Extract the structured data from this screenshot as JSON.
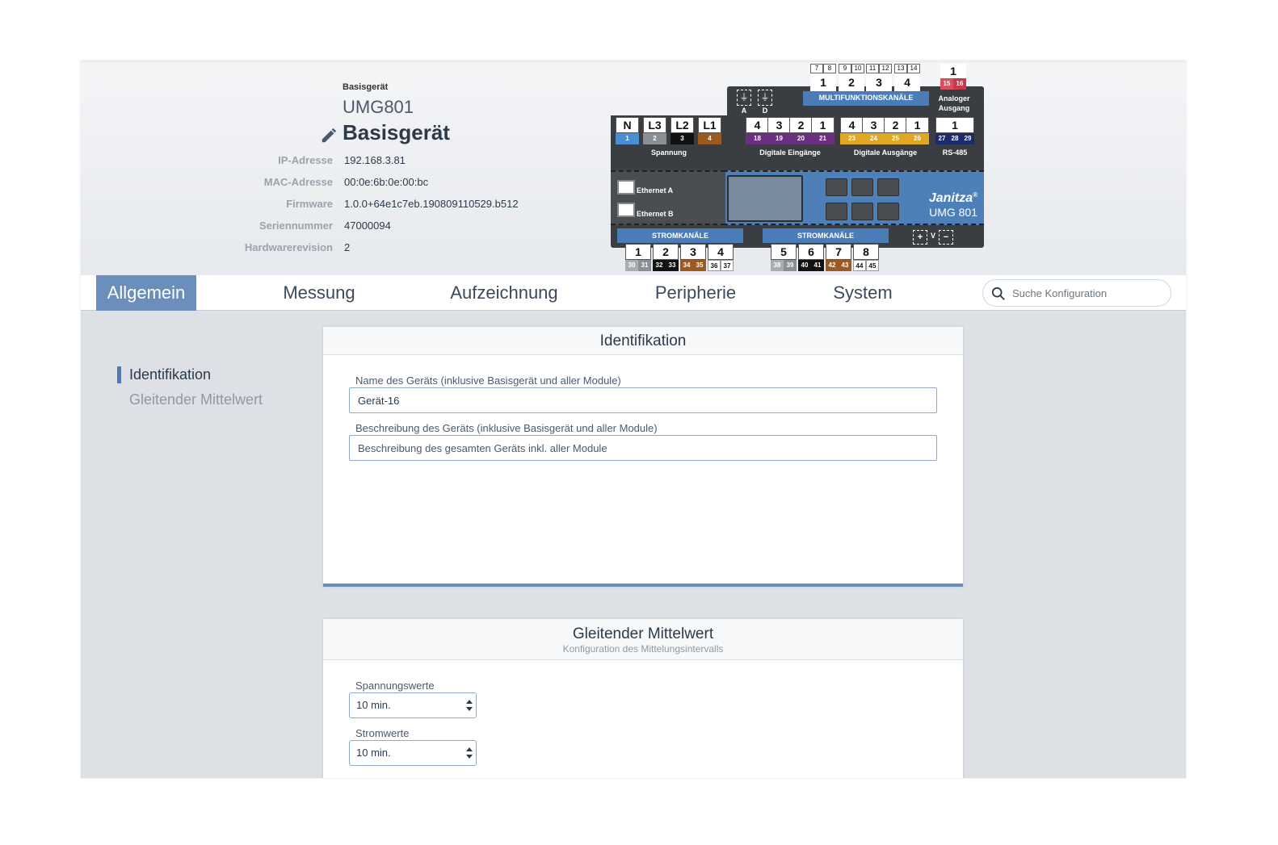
{
  "header": {
    "device_type_small": "Basisgerät",
    "device_model": "UMG801",
    "device_name": "Basisgerät",
    "info": [
      {
        "label": "IP-Adresse",
        "value": "192.168.3.81"
      },
      {
        "label": "MAC-Adresse",
        "value": "00:0e:6b:0e:00:bc"
      },
      {
        "label": "Firmware",
        "value": "1.0.0+64e1c7eb.190809110529.b512"
      },
      {
        "label": "Seriennummer",
        "value": "47000094"
      },
      {
        "label": "Hardwarerevision",
        "value": "2"
      }
    ]
  },
  "device_graphic": {
    "brand": "Janitza",
    "brand_mark": "®",
    "model": "UMG 801",
    "voltage_terminals": [
      {
        "label": "N",
        "sub": "1",
        "color": "#4a8fd4"
      },
      {
        "label": "L3",
        "sub": "2",
        "color": "#8a8f95"
      },
      {
        "label": "L2",
        "sub": "3",
        "color": "#111111"
      },
      {
        "label": "L1",
        "sub": "4",
        "color": "#9a5a22"
      }
    ],
    "voltage_label": "Spannung",
    "digital_inputs": [
      {
        "label": "4",
        "sub": "18"
      },
      {
        "label": "3",
        "sub": "19"
      },
      {
        "label": "2",
        "sub": "20"
      },
      {
        "label": "1",
        "sub": "21"
      }
    ],
    "digital_inputs_label": "Digitale Eingänge",
    "digital_outputs": [
      {
        "label": "4",
        "sub": "23"
      },
      {
        "label": "3",
        "sub": "24"
      },
      {
        "label": "2",
        "sub": "25"
      },
      {
        "label": "1",
        "sub": "26"
      }
    ],
    "digital_outputs_label": "Digitale Ausgänge",
    "rs485": {
      "label": "1",
      "subs": [
        "27",
        "28",
        "29"
      ],
      "caption": "RS-485"
    },
    "multi_label": "MULTIFUNKTIONSKANÄLE",
    "multi_small": [
      "7",
      "8",
      "9",
      "10",
      "11",
      "12",
      "13",
      "14"
    ],
    "multi_big": [
      "1",
      "2",
      "3",
      "4"
    ],
    "analog": {
      "label": "1",
      "subs": [
        "15",
        "16"
      ],
      "caption_1": "Analoger",
      "caption_2": "Ausgang"
    },
    "ad_labels": [
      "A",
      "D"
    ],
    "ethernet": [
      "Ethernet A",
      "Ethernet B"
    ],
    "current_label": "STROMKANÄLE",
    "current_left": [
      {
        "label": "1",
        "subs": [
          "30",
          "31"
        ]
      },
      {
        "label": "2",
        "subs": [
          "32",
          "33"
        ]
      },
      {
        "label": "3",
        "subs": [
          "34",
          "35"
        ]
      },
      {
        "label": "4",
        "subs": [
          "36",
          "37"
        ]
      }
    ],
    "current_right": [
      {
        "label": "5",
        "subs": [
          "38",
          "39"
        ]
      },
      {
        "label": "6",
        "subs": [
          "40",
          "41"
        ]
      },
      {
        "label": "7",
        "subs": [
          "42",
          "43"
        ]
      },
      {
        "label": "8",
        "subs": [
          "44",
          "45"
        ]
      }
    ],
    "power_symbols": [
      "+",
      "V",
      "−"
    ]
  },
  "nav": {
    "tabs": [
      {
        "label": "Allgemein",
        "active": true
      },
      {
        "label": "Messung",
        "active": false
      },
      {
        "label": "Aufzeichnung",
        "active": false
      },
      {
        "label": "Peripherie",
        "active": false
      },
      {
        "label": "System",
        "active": false
      }
    ],
    "search_placeholder": "Suche Konfiguration"
  },
  "sidebar": {
    "items": [
      {
        "label": "Identifikation",
        "active": true
      },
      {
        "label": "Gleitender Mittelwert",
        "active": false
      }
    ]
  },
  "identification": {
    "title": "Identifikation",
    "name_label": "Name des Geräts (inklusive Basisgerät und aller Module)",
    "name_value": "Gerät-16",
    "desc_label": "Beschreibung des Geräts (inklusive Basisgerät und aller Module)",
    "desc_placeholder": "Beschreibung des gesamten Geräts inkl. aller Module"
  },
  "moving_average": {
    "title": "Gleitender Mittelwert",
    "subtitle": "Konfiguration des Mittelungsintervalls",
    "voltage_label": "Spannungswerte",
    "voltage_value": "10 min.",
    "current_label": "Stromwerte",
    "current_value": "10 min."
  },
  "colors": {
    "accent": "#6b8fba",
    "accent_dark": "#4a7db8",
    "purple": "#6a2f7e",
    "yellow": "#e0a820",
    "navy": "#1a2a6a",
    "analog_red": "#d8505e"
  }
}
